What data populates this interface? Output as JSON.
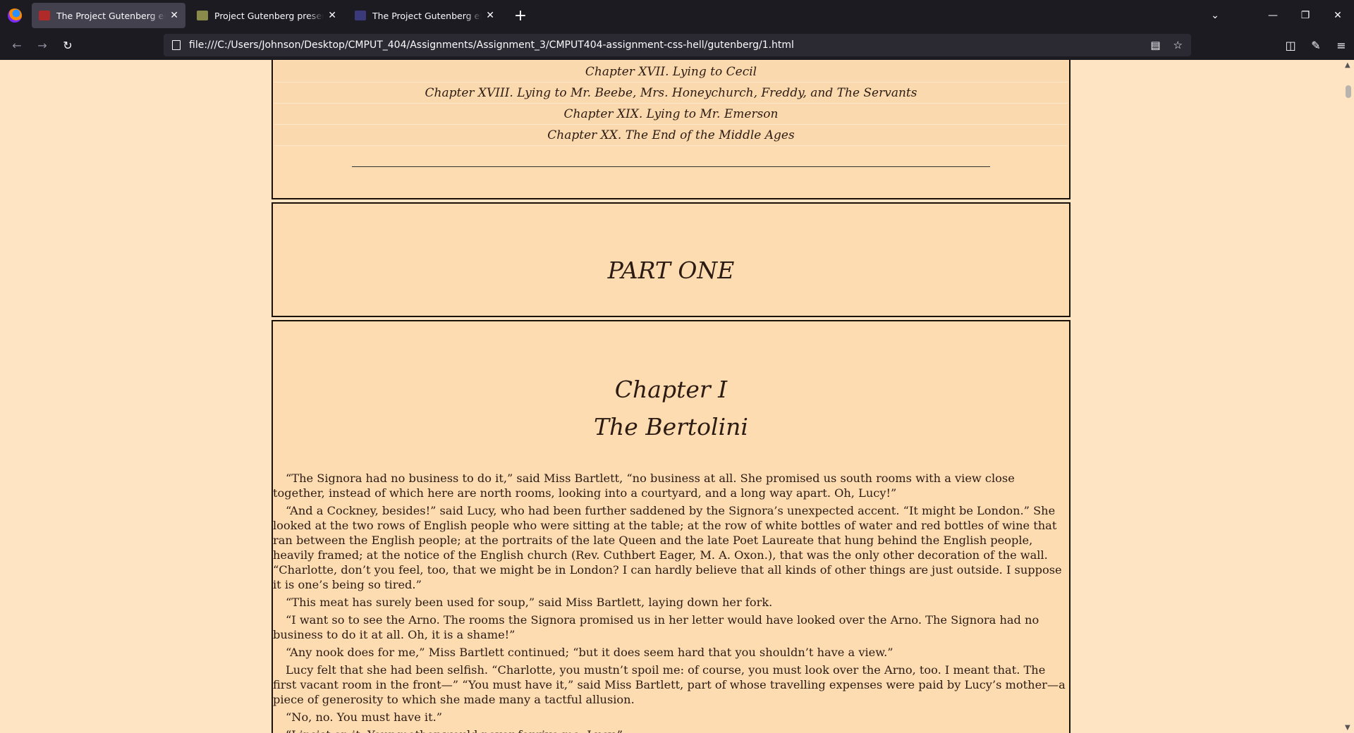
{
  "browser": {
    "tabs": [
      {
        "title": "The Project Gutenberg eBook of",
        "active": true,
        "favicon_color": "#b02a2a"
      },
      {
        "title": "Project Gutenberg presents the",
        "active": false,
        "favicon_color": "#8a8a4a"
      },
      {
        "title": "The Project Gutenberg eBook of",
        "active": false,
        "favicon_color": "#3a3a7a"
      }
    ],
    "url": "file:///C:/Users/Johnson/Desktop/CMPUT_404/Assignments/Assignment_3/CMPUT404-assignment-css-hell/gutenberg/1.html"
  },
  "toc": {
    "items": [
      "Chapter XVII. Lying to Cecil",
      "Chapter XVIII. Lying to Mr. Beebe, Mrs. Honeychurch, Freddy, and The Servants",
      "Chapter XIX. Lying to Mr. Emerson",
      "Chapter XX. The End of the Middle Ages"
    ]
  },
  "part": {
    "title": "PART ONE"
  },
  "chapter": {
    "number": "Chapter I",
    "name": "The Bertolini",
    "paragraphs": [
      "“The Signora had no business to do it,” said Miss Bartlett, “no business at all. She promised us south rooms with a view close together, instead of which here are north rooms, looking into a courtyard, and a long way apart. Oh, Lucy!”",
      "“And a Cockney, besides!” said Lucy, who had been further saddened by the Signora’s unexpected accent. “It might be London.” She looked at the two rows of English people who were sitting at the table; at the row of white bottles of water and red bottles of wine that ran between the English people; at the portraits of the late Queen and the late Poet Laureate that hung behind the English people, heavily framed; at the notice of the English church (Rev. Cuthbert Eager, M. A. Oxon.), that was the only other decoration of the wall. “Charlotte, don’t you feel, too, that we might be in London? I can hardly believe that all kinds of other things are just outside. I suppose it is one’s being so tired.”",
      "“This meat has surely been used for soup,” said Miss Bartlett, laying down her fork.",
      "“I want so to see the Arno. The rooms the Signora promised us in her letter would have looked over the Arno. The Signora had no business to do it at all. Oh, it is a shame!”",
      "“Any nook does for me,” Miss Bartlett continued; “but it does seem hard that you shouldn’t have a view.”",
      "Lucy felt that she had been selfish. “Charlotte, you mustn’t spoil me: of course, you must look over the Arno, too. I meant that. The first vacant room in the front—” “You must have it,” said Miss Bartlett, part of whose travelling expenses were paid by Lucy’s mother—a piece of generosity to which she made many a tactful allusion.",
      "“No, no. You must have it.”",
      "“I insist on it. Your mother would never forgive me, Lucy.”"
    ]
  }
}
